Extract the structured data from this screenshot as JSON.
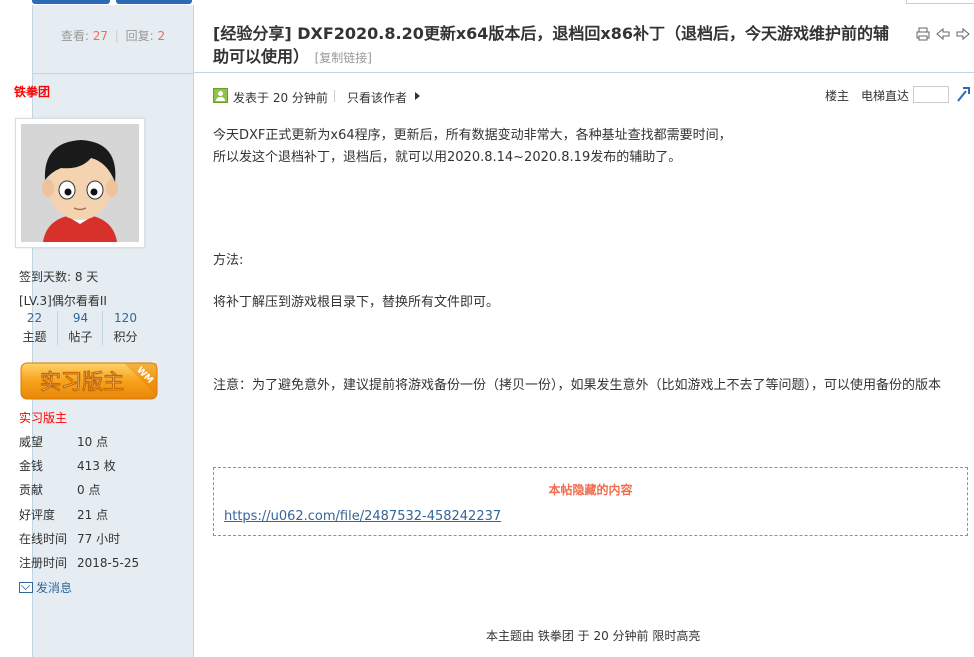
{
  "sidebar": {
    "stats": {
      "views_label": "查看:",
      "views": "27",
      "replies_label": "回复:",
      "replies": "2"
    },
    "username": "铁拳团",
    "signin_days": "签到天数: 8 天",
    "level": "[LV.3]偶尔看看II",
    "counts": [
      {
        "value": "22",
        "label": "主题"
      },
      {
        "value": "94",
        "label": "帖子"
      },
      {
        "value": "120",
        "label": "积分"
      }
    ],
    "badge": {
      "text": "实习版主",
      "corner": "WM"
    },
    "role": "实习版主",
    "props": [
      {
        "key": "威望",
        "value": "10 点"
      },
      {
        "key": "金钱",
        "value": "413 枚"
      },
      {
        "key": "贡献",
        "value": "0 点"
      },
      {
        "key": "好评度",
        "value": "21 点"
      },
      {
        "key": "在线时间",
        "value": "77 小时"
      },
      {
        "key": "注册时间",
        "value": "2018-5-25"
      }
    ],
    "send_message": "发消息"
  },
  "thread": {
    "title": "[经验分享] DXF2020.8.20更新x64版本后，退档回x86补丁（退档后，今天游戏维护前的辅助可以使用）",
    "copy_link": "[复制链接]"
  },
  "post": {
    "posted": "发表于 20 分钟前",
    "only_author": "只看该作者",
    "floor": "楼主",
    "elevator": "电梯直达",
    "content": {
      "p1": "今天DXF正式更新为x64程序，更新后，所有数据变动非常大，各种基址查找都需要时间，",
      "p2": "所以发这个退档补丁，退档后，就可以用2020.8.14~2020.8.19发布的辅助了。",
      "p3": "方法:",
      "p4": "将补丁解压到游戏根目录下，替换所有文件即可。",
      "p5": "注意：为了避免意外，建议提前将游戏备份一份（拷贝一份），如果发生意外（比如游戏上不去了等问题），可以使用备份的版本"
    },
    "hidden": {
      "title": "本帖隐藏的内容",
      "link": "https://u062.com/file/2487532-458242237"
    },
    "highlight_note": "本主题由 铁拳团 于 20 分钟前 限时高亮"
  },
  "colors": {
    "accent": "#f26c4f",
    "link": "#336699",
    "sidebar_bg": "#e5edf2",
    "border": "#c2d5e3"
  }
}
